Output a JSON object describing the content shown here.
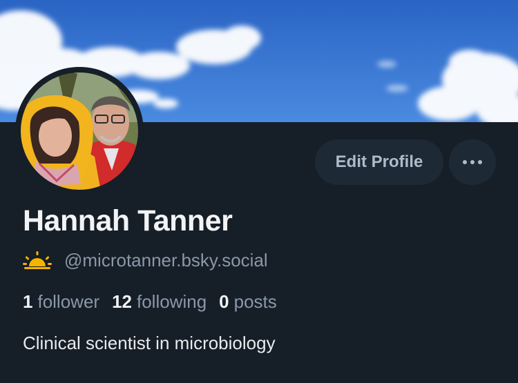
{
  "profile": {
    "display_name": "Hannah Tanner",
    "handle": "@microtanner.bsky.social",
    "bio": "Clinical scientist in microbiology"
  },
  "stats": {
    "followers_count": "1",
    "followers_label": "follower",
    "following_count": "12",
    "following_label": "following",
    "posts_count": "0",
    "posts_label": "posts"
  },
  "actions": {
    "edit_label": "Edit Profile",
    "more_icon": "ellipsis-icon"
  },
  "icons": {
    "handle_badge": "sun-icon"
  },
  "colors": {
    "background": "#161e27",
    "button_bg": "#1e2936",
    "button_text": "#aebbc9",
    "muted_text": "#8a98a9",
    "primary_text": "#f1f3f5",
    "sun": "#f5b400",
    "sky": "#2f6fcb"
  }
}
